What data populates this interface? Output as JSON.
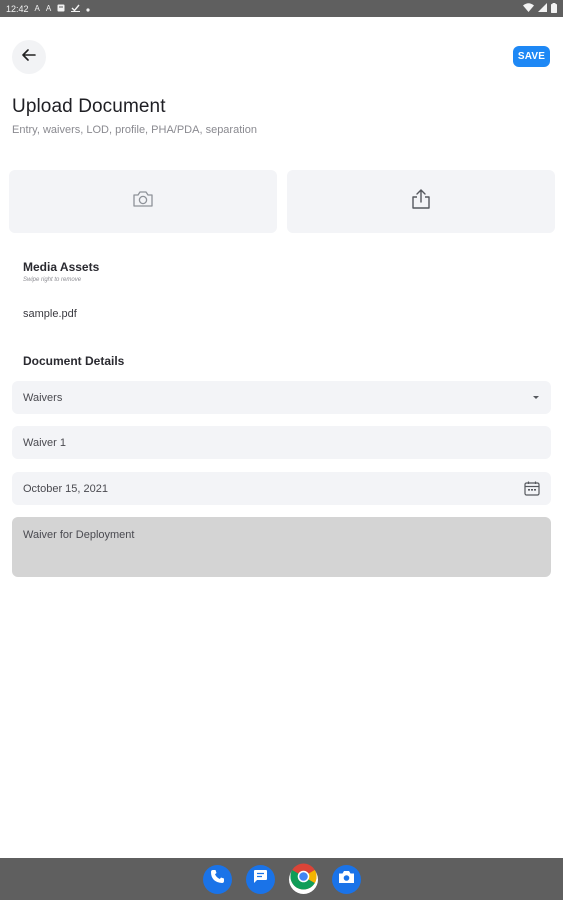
{
  "status_bar": {
    "time": "12:42"
  },
  "header": {
    "back_icon": "arrow-left-icon",
    "save_label": "SAVE",
    "title": "Upload Document",
    "subtitle": "Entry, waivers, LOD, profile, PHA/PDA, separation"
  },
  "upload_options": {
    "camera_icon": "camera-icon",
    "share_icon": "upload-share-icon"
  },
  "media_assets": {
    "title": "Media Assets",
    "hint": "Swipe right to remove",
    "files": [
      "sample.pdf"
    ]
  },
  "document_details": {
    "title": "Document Details",
    "type_value": "Waivers",
    "name_value": "Waiver 1",
    "date_value": "October 15, 2021",
    "notes_value": "Waiver for Deployment"
  },
  "dock": {
    "apps": [
      "phone-icon",
      "messages-icon",
      "chrome-icon",
      "camera-icon"
    ]
  },
  "colors": {
    "accent": "#1e88f5",
    "field_bg": "#f3f4f7",
    "notes_bg": "#d4d4d4",
    "system_bar": "#5f5f5f"
  }
}
